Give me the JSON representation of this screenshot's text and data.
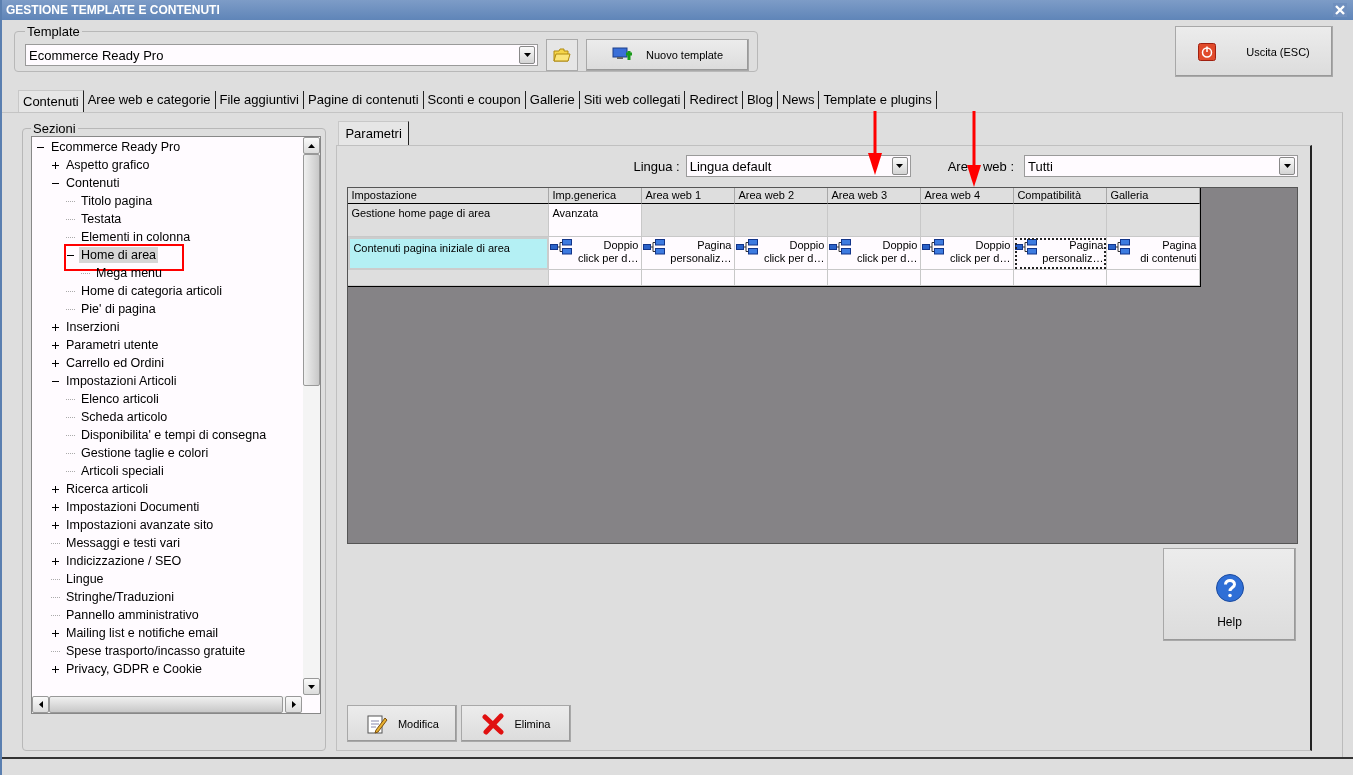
{
  "window": {
    "title": "GESTIONE TEMPLATE E CONTENUTI"
  },
  "template": {
    "group_label": "Template",
    "value": "Ecommerce Ready Pro",
    "new_button": "Nuovo template"
  },
  "exit_button": "Uscita (ESC)",
  "tabs": [
    {
      "label": "Contenuti",
      "selected": true
    },
    {
      "label": "Aree web e categorie",
      "selected": false
    },
    {
      "label": "File aggiuntivi",
      "selected": false
    },
    {
      "label": "Pagine di contenuti",
      "selected": false
    },
    {
      "label": "Sconti e coupon",
      "selected": false
    },
    {
      "label": "Gallerie",
      "selected": false
    },
    {
      "label": "Siti web collegati",
      "selected": false
    },
    {
      "label": "Redirect",
      "selected": false
    },
    {
      "label": "Blog",
      "selected": false
    },
    {
      "label": "News",
      "selected": false
    },
    {
      "label": "Template e plugins",
      "selected": false
    }
  ],
  "sections": {
    "group_label": "Sezioni",
    "tree": [
      {
        "label": "Ecommerce Ready Pro",
        "expanded": true,
        "selected": false,
        "children": [
          {
            "label": "Aspetto grafico",
            "expanded": false,
            "selected": false
          },
          {
            "label": "Contenuti",
            "expanded": true,
            "selected": false,
            "children": [
              {
                "label": "Titolo pagina",
                "selected": false
              },
              {
                "label": "Testata",
                "selected": false
              },
              {
                "label": "Elementi in colonna",
                "selected": false
              },
              {
                "label": "Home di area",
                "expanded": true,
                "selected": true,
                "marked": true,
                "children": [
                  {
                    "label": "Mega menu",
                    "selected": false
                  }
                ]
              },
              {
                "label": "Home di categoria articoli",
                "selected": false
              },
              {
                "label": "Pie' di pagina",
                "selected": false
              }
            ]
          },
          {
            "label": "Inserzioni",
            "expanded": false,
            "selected": false
          },
          {
            "label": "Parametri utente",
            "expanded": false,
            "selected": false
          },
          {
            "label": "Carrello ed Ordini",
            "expanded": false,
            "selected": false
          },
          {
            "label": "Impostazioni Articoli",
            "expanded": true,
            "selected": false,
            "children": [
              {
                "label": "Elenco articoli",
                "selected": false
              },
              {
                "label": "Scheda articolo",
                "selected": false
              },
              {
                "label": "Disponibilita' e tempi di consegna",
                "selected": false
              },
              {
                "label": "Gestione taglie e colori",
                "selected": false
              },
              {
                "label": "Articoli speciali",
                "selected": false
              }
            ]
          },
          {
            "label": "Ricerca articoli",
            "expanded": false,
            "selected": false
          },
          {
            "label": "Impostazioni Documenti",
            "expanded": false,
            "selected": false
          },
          {
            "label": "Impostazioni avanzate sito",
            "expanded": false,
            "selected": false
          },
          {
            "label": "Messaggi e testi vari",
            "selected": false
          },
          {
            "label": "Indicizzazione / SEO",
            "expanded": false,
            "selected": false
          },
          {
            "label": "Lingue",
            "selected": false
          },
          {
            "label": "Stringhe/Traduzioni",
            "selected": false
          },
          {
            "label": "Pannello amministrativo",
            "selected": false
          },
          {
            "label": "Mailing list e notifiche email",
            "expanded": false,
            "selected": false
          },
          {
            "label": "Spese trasporto/incasso gratuite",
            "selected": false
          },
          {
            "label": "Privacy, GDPR e Cookie",
            "expanded": false,
            "selected": false
          }
        ]
      }
    ]
  },
  "parameters": {
    "tab": "Parametri",
    "language_label": "Lingua :",
    "language": "Lingua default",
    "area_label_parts": [
      "Are",
      "web :"
    ],
    "area": "Tutti",
    "grid": {
      "columns": [
        {
          "label": "Impostazione"
        },
        {
          "label": "Imp.generica"
        },
        {
          "label": "Area web 1"
        },
        {
          "label": "Area web 2"
        },
        {
          "label": "Area web 3",
          "marked": true
        },
        {
          "label": "Area web 4",
          "marked": true
        },
        {
          "label": "Compatibilità"
        },
        {
          "label": "Galleria"
        }
      ],
      "rows": [
        {
          "selected": false,
          "cells": [
            {
              "kind": "setting",
              "value": "Gestione home page di area"
            },
            {
              "kind": "text",
              "value": "Avanzata"
            },
            {
              "kind": "empty"
            },
            {
              "kind": "empty"
            },
            {
              "kind": "empty"
            },
            {
              "kind": "empty"
            },
            {
              "kind": "empty"
            },
            {
              "kind": "empty"
            }
          ]
        },
        {
          "selected": true,
          "cells": [
            {
              "kind": "setting",
              "value": "Contenuti pagina iniziale di area"
            },
            {
              "kind": "link",
              "lines": [
                "Doppio",
                "click per d…"
              ],
              "focused": false
            },
            {
              "kind": "link",
              "lines": [
                "Pagina",
                "personaliz…"
              ],
              "focused": false
            },
            {
              "kind": "link",
              "lines": [
                "Doppio",
                "click per d…"
              ],
              "focused": false
            },
            {
              "kind": "link",
              "lines": [
                "Doppio",
                "click per d…"
              ],
              "focused": false
            },
            {
              "kind": "link",
              "lines": [
                "Doppio",
                "click per d…"
              ],
              "focused": false
            },
            {
              "kind": "link",
              "lines": [
                "Pagina",
                "personaliz…"
              ],
              "focused": true
            },
            {
              "kind": "link",
              "lines": [
                "Pagina",
                "di contenuti"
              ],
              "focused": false
            }
          ]
        }
      ]
    },
    "help_button": "Help",
    "edit_button": "Modifica",
    "delete_button": "Elimina"
  }
}
